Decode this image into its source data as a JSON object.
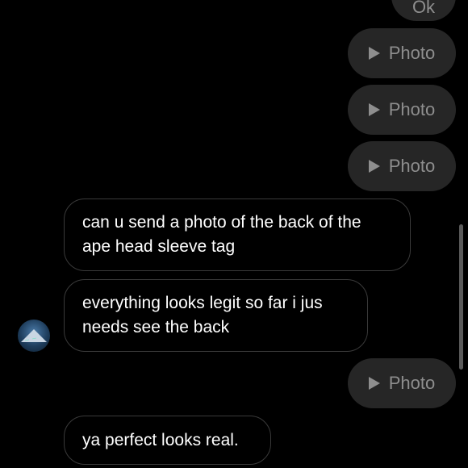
{
  "messages": {
    "top_partial": "Ok",
    "photo_label": "Photo",
    "incoming_1": "can u send a photo of the back of the ape head sleeve tag",
    "incoming_2": "everything looks legit so far i jus needs see the back",
    "incoming_3": "ya perfect looks real."
  },
  "colors": {
    "background": "#000000",
    "outgoing_bubble": "#262626",
    "outgoing_text": "#8e8e8e",
    "incoming_border": "#3a3a3a"
  }
}
